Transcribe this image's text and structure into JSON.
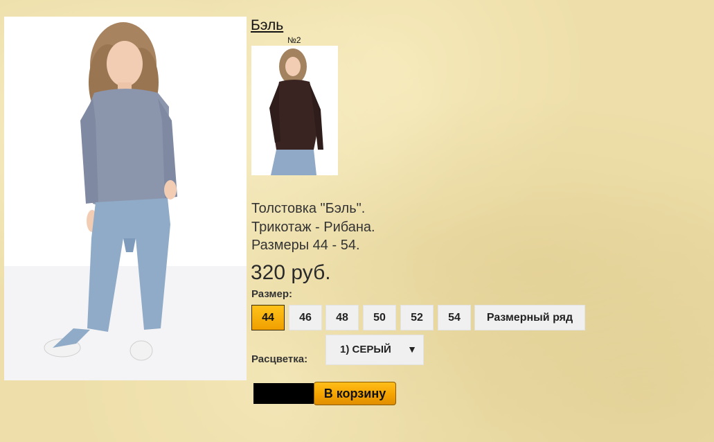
{
  "product": {
    "title": "Бэль",
    "thumb_label": "№2",
    "description": [
      "Толстовка \"Бэль\".",
      "Трикотаж - Рибана.",
      "Размеры 44 - 54."
    ],
    "price": "320 руб."
  },
  "size": {
    "label": "Размер:",
    "options": [
      "44",
      "46",
      "48",
      "50",
      "52",
      "54"
    ],
    "selected": "44",
    "chart_button": "Размерный ряд"
  },
  "color": {
    "label": "Расцветка:",
    "selected": "1) СЕРЫЙ"
  },
  "cart": {
    "button_label": "В корзину"
  },
  "colors": {
    "background": "#eedfaa",
    "accent": "#f5a300",
    "button_bg": "#f0f0f0"
  }
}
